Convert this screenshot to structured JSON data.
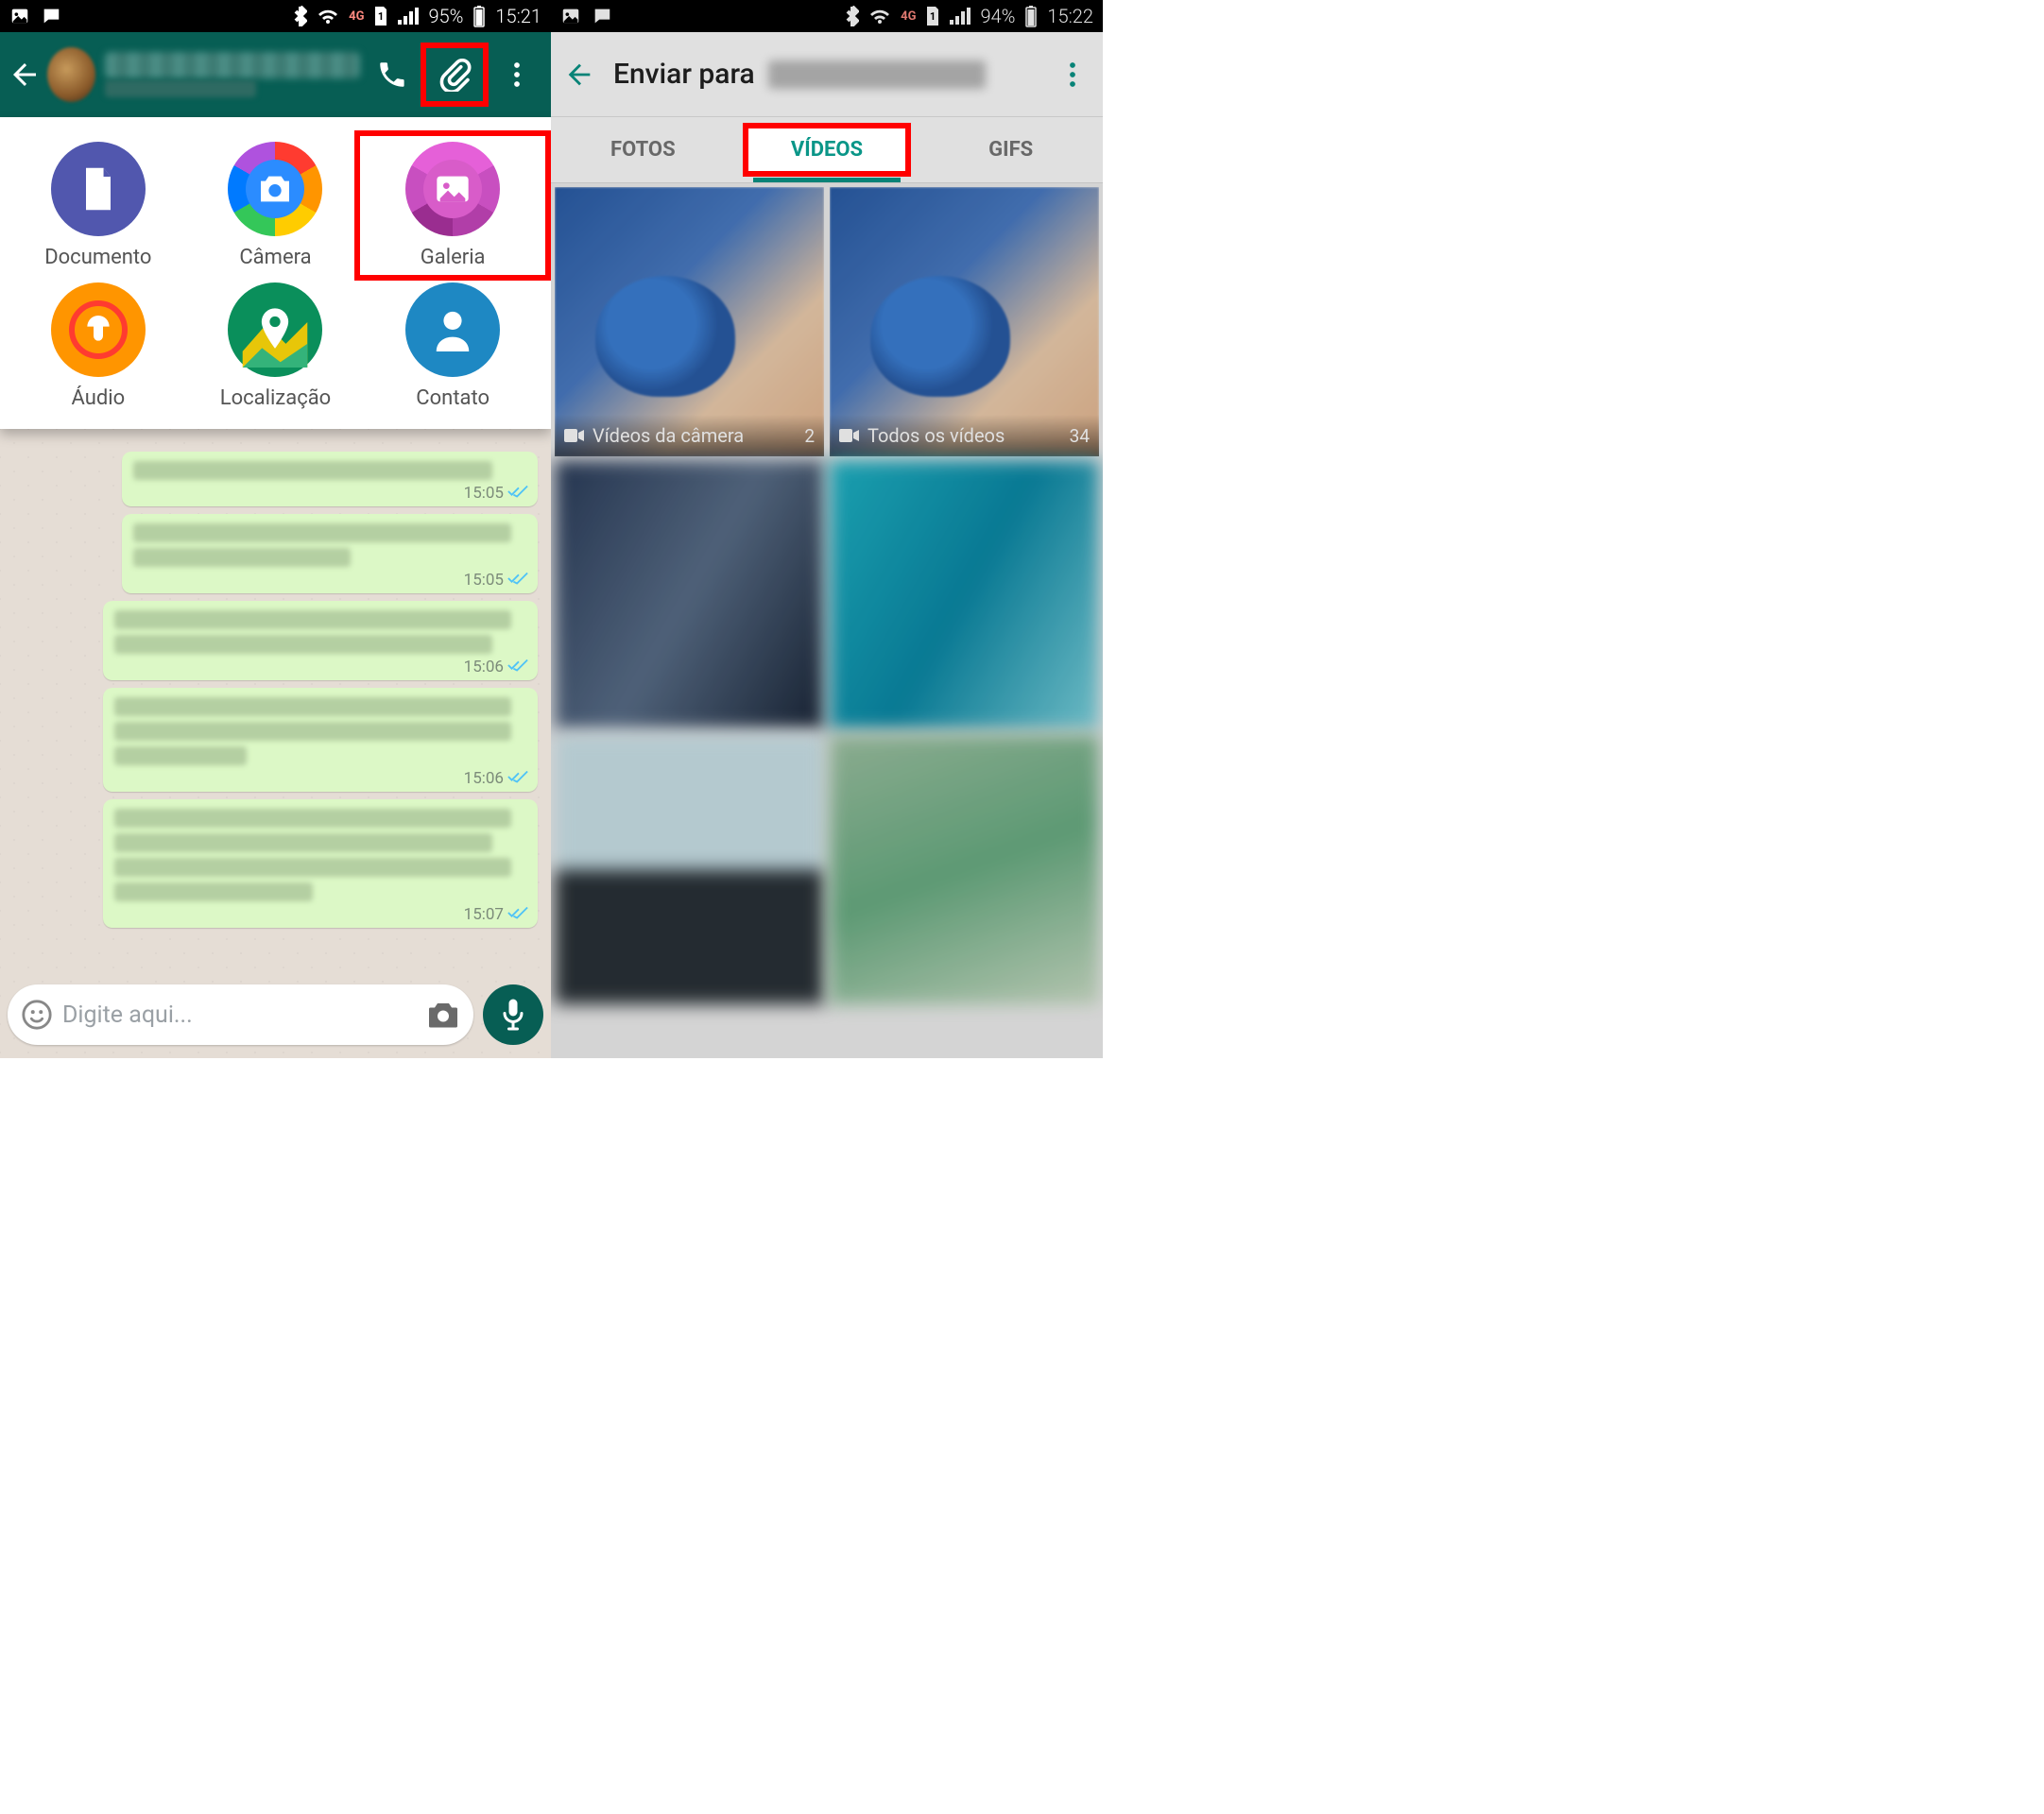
{
  "left": {
    "status": {
      "battery": "95%",
      "time": "15:21",
      "network": "4G"
    },
    "attach_sheet": {
      "items": [
        {
          "label": "Documento"
        },
        {
          "label": "Câmera"
        },
        {
          "label": "Galeria"
        },
        {
          "label": "Áudio"
        },
        {
          "label": "Localização"
        },
        {
          "label": "Contato"
        }
      ]
    },
    "messages": [
      {
        "time": "15:05"
      },
      {
        "time": "15:05"
      },
      {
        "time": "15:06"
      },
      {
        "time": "15:06"
      },
      {
        "time": "15:07"
      }
    ],
    "input": {
      "placeholder": "Digite aqui..."
    },
    "highlight": {
      "attach": true,
      "gallery": true
    }
  },
  "right": {
    "status": {
      "battery": "94%",
      "time": "15:22",
      "network": "4G"
    },
    "header": {
      "title": "Enviar para"
    },
    "tabs": {
      "items": [
        "FOTOS",
        "VÍDEOS",
        "GIFS"
      ],
      "active": "VÍDEOS"
    },
    "albums": [
      {
        "title": "Vídeos da câmera",
        "count": "2"
      },
      {
        "title": "Todos os vídeos",
        "count": "34"
      }
    ]
  }
}
